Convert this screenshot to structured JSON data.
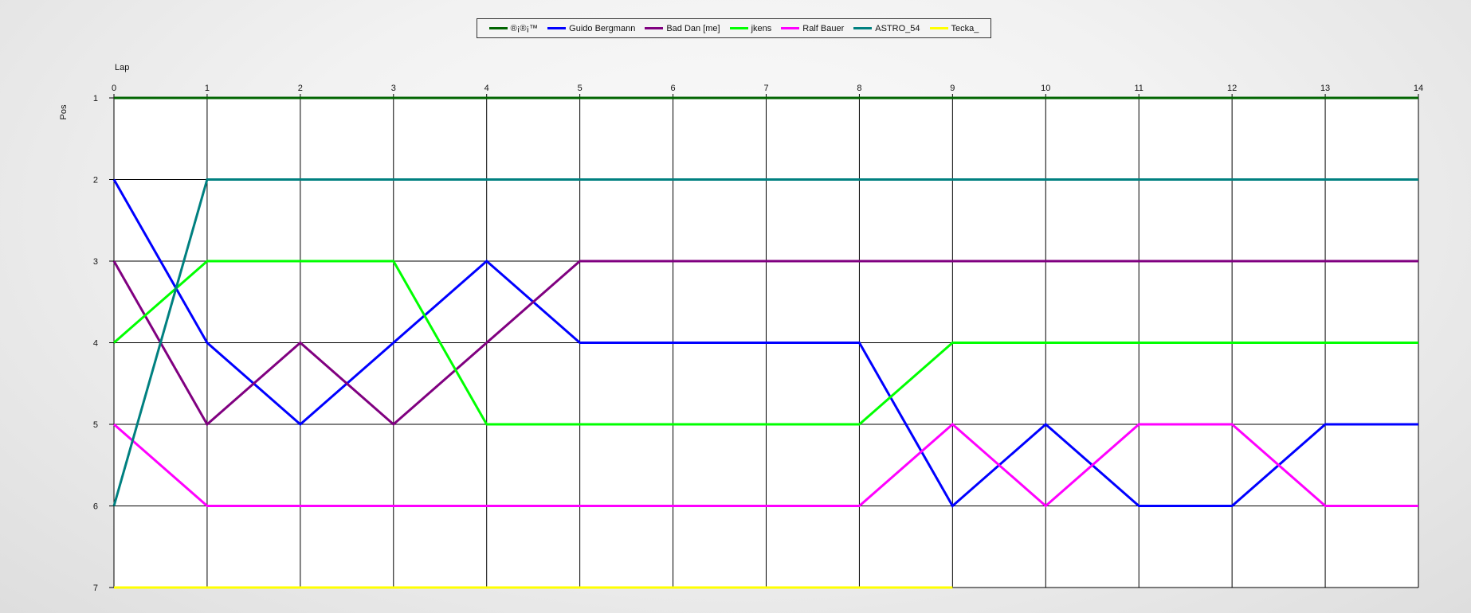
{
  "chart_data": {
    "type": "line",
    "xlabel": "Lap",
    "ylabel": "Pos",
    "xlim": [
      0,
      14
    ],
    "ylim": [
      1,
      7
    ],
    "y_inverted": true,
    "x_ticks": [
      0,
      1,
      2,
      3,
      4,
      5,
      6,
      7,
      8,
      9,
      10,
      11,
      12,
      13,
      14
    ],
    "y_ticks": [
      1,
      2,
      3,
      4,
      5,
      6,
      7
    ],
    "grid": true,
    "legend_position": "top-center",
    "series": [
      {
        "name": "®¡®¡™",
        "color": "#006400",
        "x": [
          0,
          1,
          2,
          3,
          4,
          5,
          6,
          7,
          8,
          9,
          10,
          11,
          12,
          13,
          14
        ],
        "y": [
          1,
          1,
          1,
          1,
          1,
          1,
          1,
          1,
          1,
          1,
          1,
          1,
          1,
          1,
          1
        ]
      },
      {
        "name": "Guido Bergmann",
        "color": "#0000ff",
        "x": [
          0,
          1,
          2,
          3,
          4,
          5,
          6,
          7,
          8,
          9,
          10,
          11,
          12,
          13,
          14
        ],
        "y": [
          2,
          4,
          5,
          4,
          3,
          4,
          4,
          4,
          4,
          6,
          5,
          6,
          6,
          5,
          5
        ]
      },
      {
        "name": "Bad Dan [me]",
        "color": "#800080",
        "x": [
          0,
          1,
          2,
          3,
          4,
          5,
          6,
          7,
          8,
          9,
          10,
          11,
          12,
          13,
          14
        ],
        "y": [
          3,
          5,
          4,
          5,
          4,
          3,
          3,
          3,
          3,
          3,
          3,
          3,
          3,
          3,
          3
        ]
      },
      {
        "name": "jkens",
        "color": "#00ff00",
        "x": [
          0,
          1,
          2,
          3,
          4,
          5,
          6,
          7,
          8,
          9,
          10,
          11,
          12,
          13,
          14
        ],
        "y": [
          4,
          3,
          3,
          3,
          5,
          5,
          5,
          5,
          5,
          4,
          4,
          4,
          4,
          4,
          4
        ]
      },
      {
        "name": "Ralf Bauer",
        "color": "#ff00ff",
        "x": [
          0,
          1,
          2,
          3,
          4,
          5,
          6,
          7,
          8,
          9,
          10,
          11,
          12,
          13,
          14
        ],
        "y": [
          5,
          6,
          6,
          6,
          6,
          6,
          6,
          6,
          6,
          5,
          6,
          5,
          5,
          6,
          6
        ]
      },
      {
        "name": "ASTRO_54",
        "color": "#008080",
        "x": [
          0,
          1,
          2,
          3,
          4,
          5,
          6,
          7,
          8,
          9,
          10,
          11,
          12,
          13,
          14
        ],
        "y": [
          6,
          2,
          2,
          2,
          2,
          2,
          2,
          2,
          2,
          2,
          2,
          2,
          2,
          2,
          2
        ]
      },
      {
        "name": "Tecka_",
        "color": "#ffff00",
        "x": [
          0,
          1,
          2,
          3,
          4,
          5,
          6,
          7,
          8,
          9
        ],
        "y": [
          7,
          7,
          7,
          7,
          7,
          7,
          7,
          7,
          7,
          7
        ]
      }
    ]
  }
}
